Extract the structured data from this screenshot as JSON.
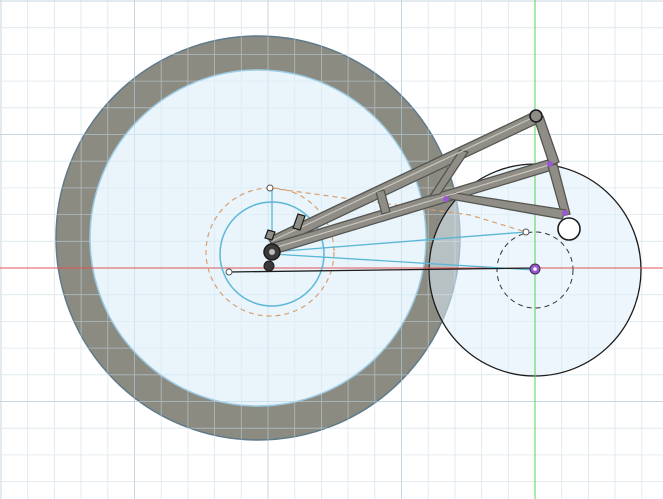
{
  "app": {
    "kind": "cad-sketch-viewport",
    "background": "#ffffff"
  },
  "colors": {
    "grid_minor": "#eeeeee",
    "grid_major": "#d9d9d9",
    "x_axis": "#e05555",
    "y_axis": "#55d455",
    "tire_fill": "#8b8b82",
    "tire_stroke": "#5f7a8a",
    "disc_fill": "#e9f4fb",
    "disc_stroke": "#9ccbe3",
    "tube_fill": "#8f8d86",
    "tube_stroke": "#545450",
    "tube_highlight": "#c7c5bd",
    "sketch_blue": "#5bb7d6",
    "sketch_orange": "#d8a070",
    "sketch_black": "#1c1c1c",
    "sketch_point": "#9b59d0"
  },
  "icons": [
    "pivot-point-icon",
    "sketch-point-icon",
    "bolt-icon"
  ]
}
